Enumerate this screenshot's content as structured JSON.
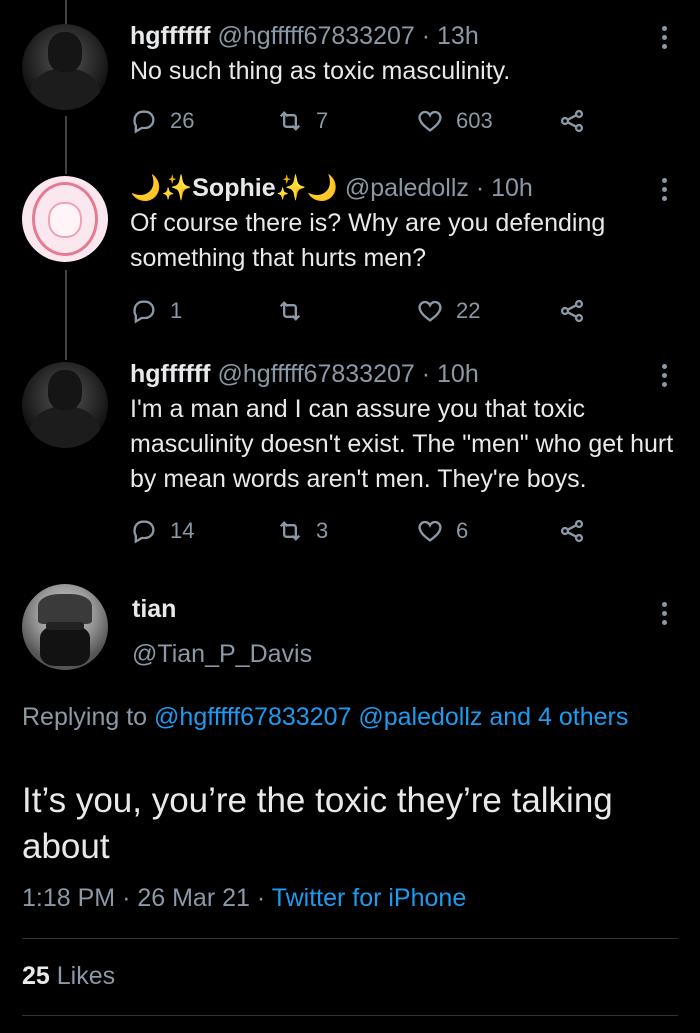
{
  "tweets": [
    {
      "name": "hgffffff",
      "handle": "@hgfffff67833207",
      "separator": "·",
      "time": "13h",
      "text": "No such thing as toxic masculinity.",
      "replies": "26",
      "retweets": "7",
      "likes": "603"
    },
    {
      "name": "🌙✨Sophie✨🌙",
      "handle": "@paledollz",
      "separator": "·",
      "time": "10h",
      "text": "Of course there is? Why are you defending something that hurts men?",
      "replies": "1",
      "retweets": "",
      "likes": "22"
    },
    {
      "name": "hgffffff",
      "handle": "@hgfffff67833207",
      "separator": "·",
      "time": "10h",
      "text": "I'm a man and I can assure you that toxic masculinity doesn't exist. The \"men\" who get hurt by mean words aren't men. They're boys.",
      "replies": "14",
      "retweets": "3",
      "likes": "6"
    }
  ],
  "main_tweet": {
    "name": "tian",
    "handle": "@Tian_P_Davis",
    "replying_prefix": "Replying to",
    "replying_mention_1": "@hgfffff67833207",
    "replying_mention_2": "@paledollz",
    "replying_others": "and 4 others",
    "text": "It’s you, you’re the toxic they’re talking about",
    "time": "1:18 PM",
    "separator": "·",
    "date": "26 Mar 21",
    "source": "Twitter for iPhone",
    "likes_count": "25",
    "likes_label": "Likes"
  },
  "colors": {
    "background": "#000000",
    "text": "#e7e9ea",
    "muted": "#8b98a5",
    "link": "#1d9bf0"
  },
  "icons": [
    "reply-icon",
    "retweet-icon",
    "like-icon",
    "share-icon",
    "more-icon"
  ]
}
